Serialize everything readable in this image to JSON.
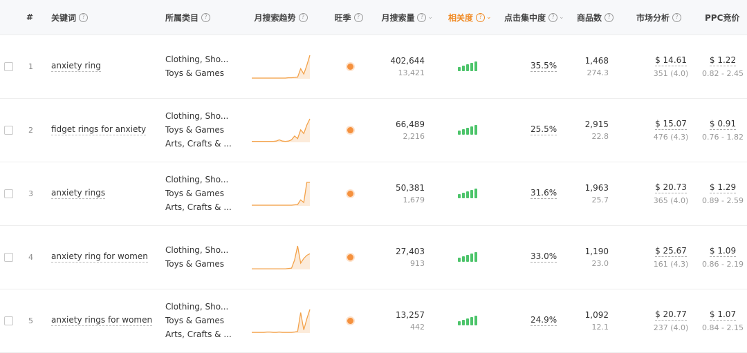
{
  "header": {
    "index": "#",
    "keyword": "关键词",
    "category": "所属类目",
    "trend": "月搜索趋势",
    "season": "旺季",
    "search_volume": "月搜索量",
    "relevance": "相关度",
    "click_concentration": "点击集中度",
    "products": "商品数",
    "market": "市场分析",
    "ppc": "PPC竞价"
  },
  "colors": {
    "accent": "#f08a24",
    "relevance_bar": "#4cc46a",
    "season_dot": "#f5913e",
    "trend_line": "#f3a24a"
  },
  "rows": [
    {
      "index": "1",
      "keyword": "anxiety ring",
      "categories": [
        "Clothing, Sho...",
        "Toys & Games"
      ],
      "trend": [
        2,
        2,
        2,
        2,
        2,
        2,
        2,
        2,
        2,
        2,
        2,
        2,
        3,
        3,
        4,
        5,
        30,
        14,
        40,
        70
      ],
      "volume": "402,644",
      "volume_sub": "13,421",
      "relevance_level": 5,
      "click": "35.5%",
      "products": "1,468",
      "products_sub": "274.3",
      "price": "$ 14.61",
      "price_sub": "351 (4.0)",
      "ppc": "$ 1.22",
      "ppc_range": "0.82 - 2.45"
    },
    {
      "index": "2",
      "keyword": "fidget rings for anxiety",
      "categories": [
        "Clothing, Sho...",
        "Toys & Games",
        "Arts, Crafts & ..."
      ],
      "trend": [
        3,
        3,
        3,
        3,
        3,
        3,
        3,
        3,
        4,
        8,
        4,
        3,
        4,
        8,
        20,
        12,
        40,
        28,
        55,
        75
      ],
      "volume": "66,489",
      "volume_sub": "2,216",
      "relevance_level": 5,
      "click": "25.5%",
      "products": "2,915",
      "products_sub": "22.8",
      "price": "$ 15.07",
      "price_sub": "476 (4.3)",
      "ppc": "$ 0.91",
      "ppc_range": "0.76 - 1.82"
    },
    {
      "index": "3",
      "keyword": "anxiety rings",
      "categories": [
        "Clothing, Sho...",
        "Toys & Games",
        "Arts, Crafts & ..."
      ],
      "trend": [
        2,
        2,
        2,
        2,
        2,
        2,
        2,
        2,
        2,
        2,
        2,
        2,
        2,
        2,
        3,
        4,
        18,
        10,
        70,
        70
      ],
      "volume": "50,381",
      "volume_sub": "1,679",
      "relevance_level": 5,
      "click": "31.6%",
      "products": "1,963",
      "products_sub": "25.7",
      "price": "$ 20.73",
      "price_sub": "365 (4.0)",
      "ppc": "$ 1.29",
      "ppc_range": "0.89 - 2.59"
    },
    {
      "index": "4",
      "keyword": "anxiety ring for women",
      "categories": [
        "Clothing, Sho...",
        "Toys & Games"
      ],
      "trend": [
        2,
        2,
        2,
        2,
        2,
        2,
        2,
        2,
        2,
        2,
        2,
        2,
        3,
        4,
        30,
        75,
        20,
        35,
        45,
        50
      ],
      "volume": "27,403",
      "volume_sub": "913",
      "relevance_level": 5,
      "click": "33.0%",
      "products": "1,190",
      "products_sub": "23.0",
      "price": "$ 25.67",
      "price_sub": "161 (4.3)",
      "ppc": "$ 1.09",
      "ppc_range": "0.86 - 2.19"
    },
    {
      "index": "5",
      "keyword": "anxiety rings for women",
      "categories": [
        "Clothing, Sho...",
        "Toys & Games",
        "Arts, Crafts & ..."
      ],
      "trend": [
        2,
        2,
        2,
        2,
        2,
        3,
        3,
        2,
        2,
        3,
        2,
        2,
        2,
        2,
        3,
        5,
        65,
        10,
        45,
        75
      ],
      "volume": "13,257",
      "volume_sub": "442",
      "relevance_level": 5,
      "click": "24.9%",
      "products": "1,092",
      "products_sub": "12.1",
      "price": "$ 20.77",
      "price_sub": "237 (4.0)",
      "ppc": "$ 1.07",
      "ppc_range": "0.84 - 2.15"
    }
  ]
}
